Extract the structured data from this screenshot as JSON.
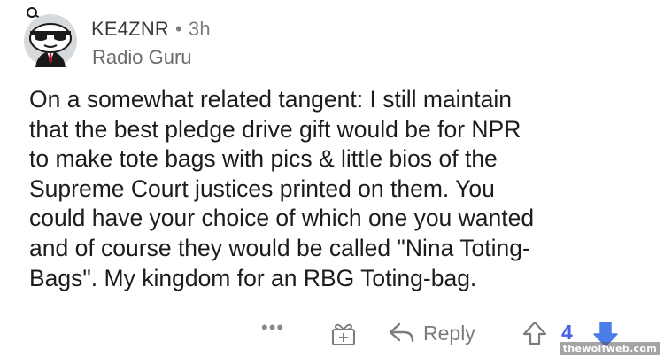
{
  "comment": {
    "author": "KE4ZNR",
    "separator": "•",
    "age": "3h",
    "flair": "Radio Guru",
    "body": "On a somewhat related tangent: I still maintain\nthat the best pledge drive gift would be for NPR\nto make tote bags with pics & little bios of the\nSupreme Court justices printed on them. You\ncould have your choice of which one you wanted\nand of course they would be called \"Nina Toting-\nBags\". My kingdom for an RBG Toting-bag."
  },
  "actions": {
    "more": "•••",
    "award_icon": "gift-award-icon",
    "reply_icon": "reply-arrow-icon",
    "reply_label": "Reply",
    "upvote_icon": "upvote-arrow-icon",
    "score": "4",
    "downvote_icon": "downvote-arrow-icon"
  },
  "watermark": "thewolfweb.com",
  "colors": {
    "score": "#4a5ee7",
    "downvote_active": "#4a7de8",
    "muted": "#7c7c7c"
  }
}
